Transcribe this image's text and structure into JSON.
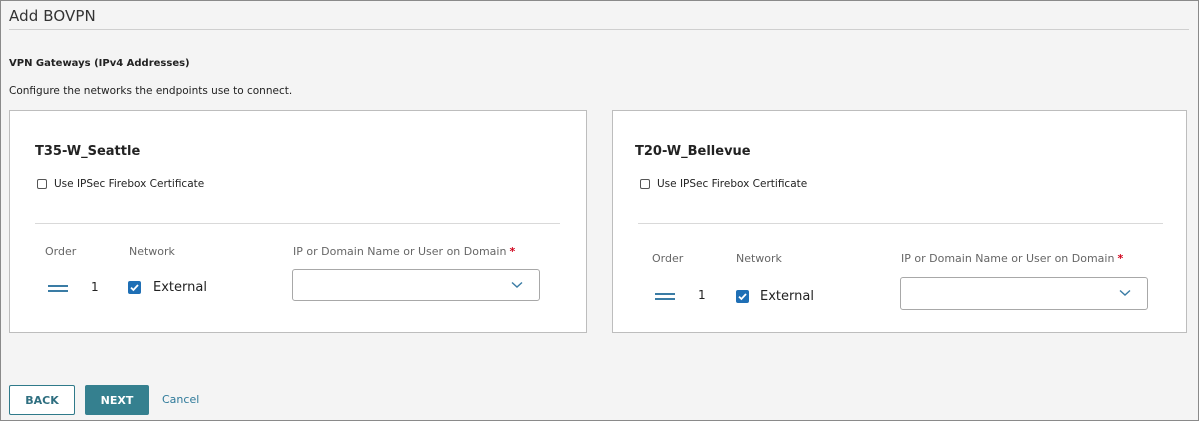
{
  "page": {
    "title": "Add BOVPN"
  },
  "section": {
    "title": "VPN Gateways (IPv4 Addresses)",
    "description": "Configure the networks the endpoints use to connect."
  },
  "gateways": [
    {
      "name": "T35-W_Seattle",
      "cert_label": "Use IPSec Firebox Certificate",
      "cert_checked": false,
      "columns": {
        "order": "Order",
        "network": "Network",
        "ip": "IP or Domain Name or User on Domain",
        "required": "*"
      },
      "row": {
        "order": "1",
        "network": "External",
        "network_checked": true,
        "ip_value": ""
      }
    },
    {
      "name": "T20-W_Bellevue",
      "cert_label": "Use IPSec Firebox Certificate",
      "cert_checked": false,
      "columns": {
        "order": "Order",
        "network": "Network",
        "ip": "IP or Domain Name or User on Domain",
        "required": "*"
      },
      "row": {
        "order": "1",
        "network": "External",
        "network_checked": true,
        "ip_value": ""
      }
    }
  ],
  "buttons": {
    "back": "BACK",
    "next": "NEXT",
    "cancel": "Cancel"
  },
  "colors": {
    "accent": "#35808f",
    "checkbox": "#1f6fb5",
    "required": "#d0021b"
  },
  "icons": {
    "drag": "drag-handle-icon",
    "dropdown": "chevron-down-icon",
    "check": "check-icon"
  }
}
